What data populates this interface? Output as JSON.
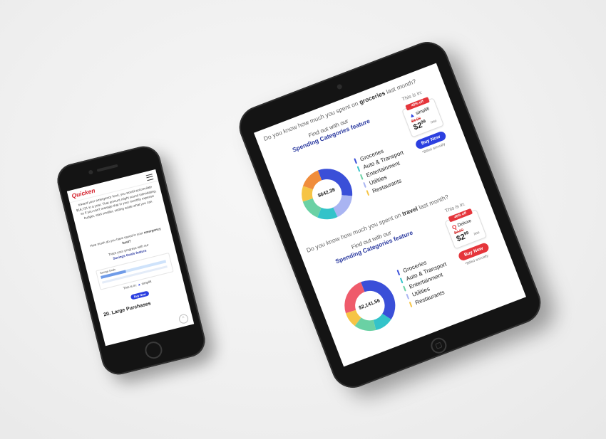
{
  "colors": {
    "primary_blue": "#2b3fe0",
    "quicken_red": "#e5353b",
    "link_blue": "#2b3aa0",
    "series": [
      "#3a4fd8",
      "#33c3c9",
      "#6ad1a4",
      "#f6c445",
      "#f08d3c",
      "#ef5b6b",
      "#a9b4f2"
    ]
  },
  "tablet": {
    "section1": {
      "question_pre": "Do you know how much you spent on ",
      "question_bold": "groceries",
      "question_post": " last month?",
      "find_out": "Find out with our",
      "feature": "Spending Categories feature",
      "total": "$642.38",
      "legend": [
        "Groceries",
        "Auto & Transport",
        "Entertainment",
        "Utilities",
        "Restaurants"
      ],
      "this_is_in": "This is in:",
      "badge": "40% off",
      "product": "simplifi",
      "old_price": "$3.99",
      "price_main": "$2",
      "price_cents": "99",
      "per": "/mo",
      "buy": "Buy Now",
      "billed": "*Billed annually"
    },
    "section2": {
      "question_pre": "Do you know how much you spent on ",
      "question_bold": "travel",
      "question_post": " last month?",
      "find_out": "Find out with our",
      "feature": "Spending Categories feature",
      "total": "$2,141.56",
      "legend": [
        "Groceries",
        "Auto & Transport",
        "Entertainment",
        "Utilities",
        "Restaurants"
      ],
      "this_is_in": "This is in:",
      "badge": "40% off",
      "product": "Deluxe",
      "old_price": "$4.99",
      "price_main": "$2",
      "price_cents": "99",
      "per": "/mo",
      "buy": "Buy Now",
      "billed": "*Billed annually"
    }
  },
  "chart_data": [
    {
      "type": "pie",
      "title": "$642.38",
      "categories": [
        "Blue",
        "Light blue",
        "Teal",
        "Green",
        "Yellow",
        "Orange"
      ],
      "values": [
        32,
        17,
        13,
        14,
        10,
        14
      ]
    },
    {
      "type": "pie",
      "title": "$2,141.56",
      "categories": [
        "Blue",
        "Teal",
        "Green",
        "Yellow",
        "Red"
      ],
      "values": [
        40,
        12,
        14,
        10,
        24
      ]
    }
  ],
  "phone": {
    "logo": "Quicken",
    "para1": "toward your emergency fund, you would accumulate $16,731 in a year. That amount might sound intimidating, so if you can't manage that in your monthly expense budget, start smaller, setting aside what you can.",
    "para2_pre": "How much do you have saved in your ",
    "para2_bold": "emergency fund?",
    "track": "Track your progress with our",
    "feature": "Savings Goals feature",
    "box_title": "Savings Goals",
    "this_is_in": "This is in:",
    "product": "simplifi",
    "buy": "Buy Now",
    "heading": "20. Large Purchases"
  }
}
